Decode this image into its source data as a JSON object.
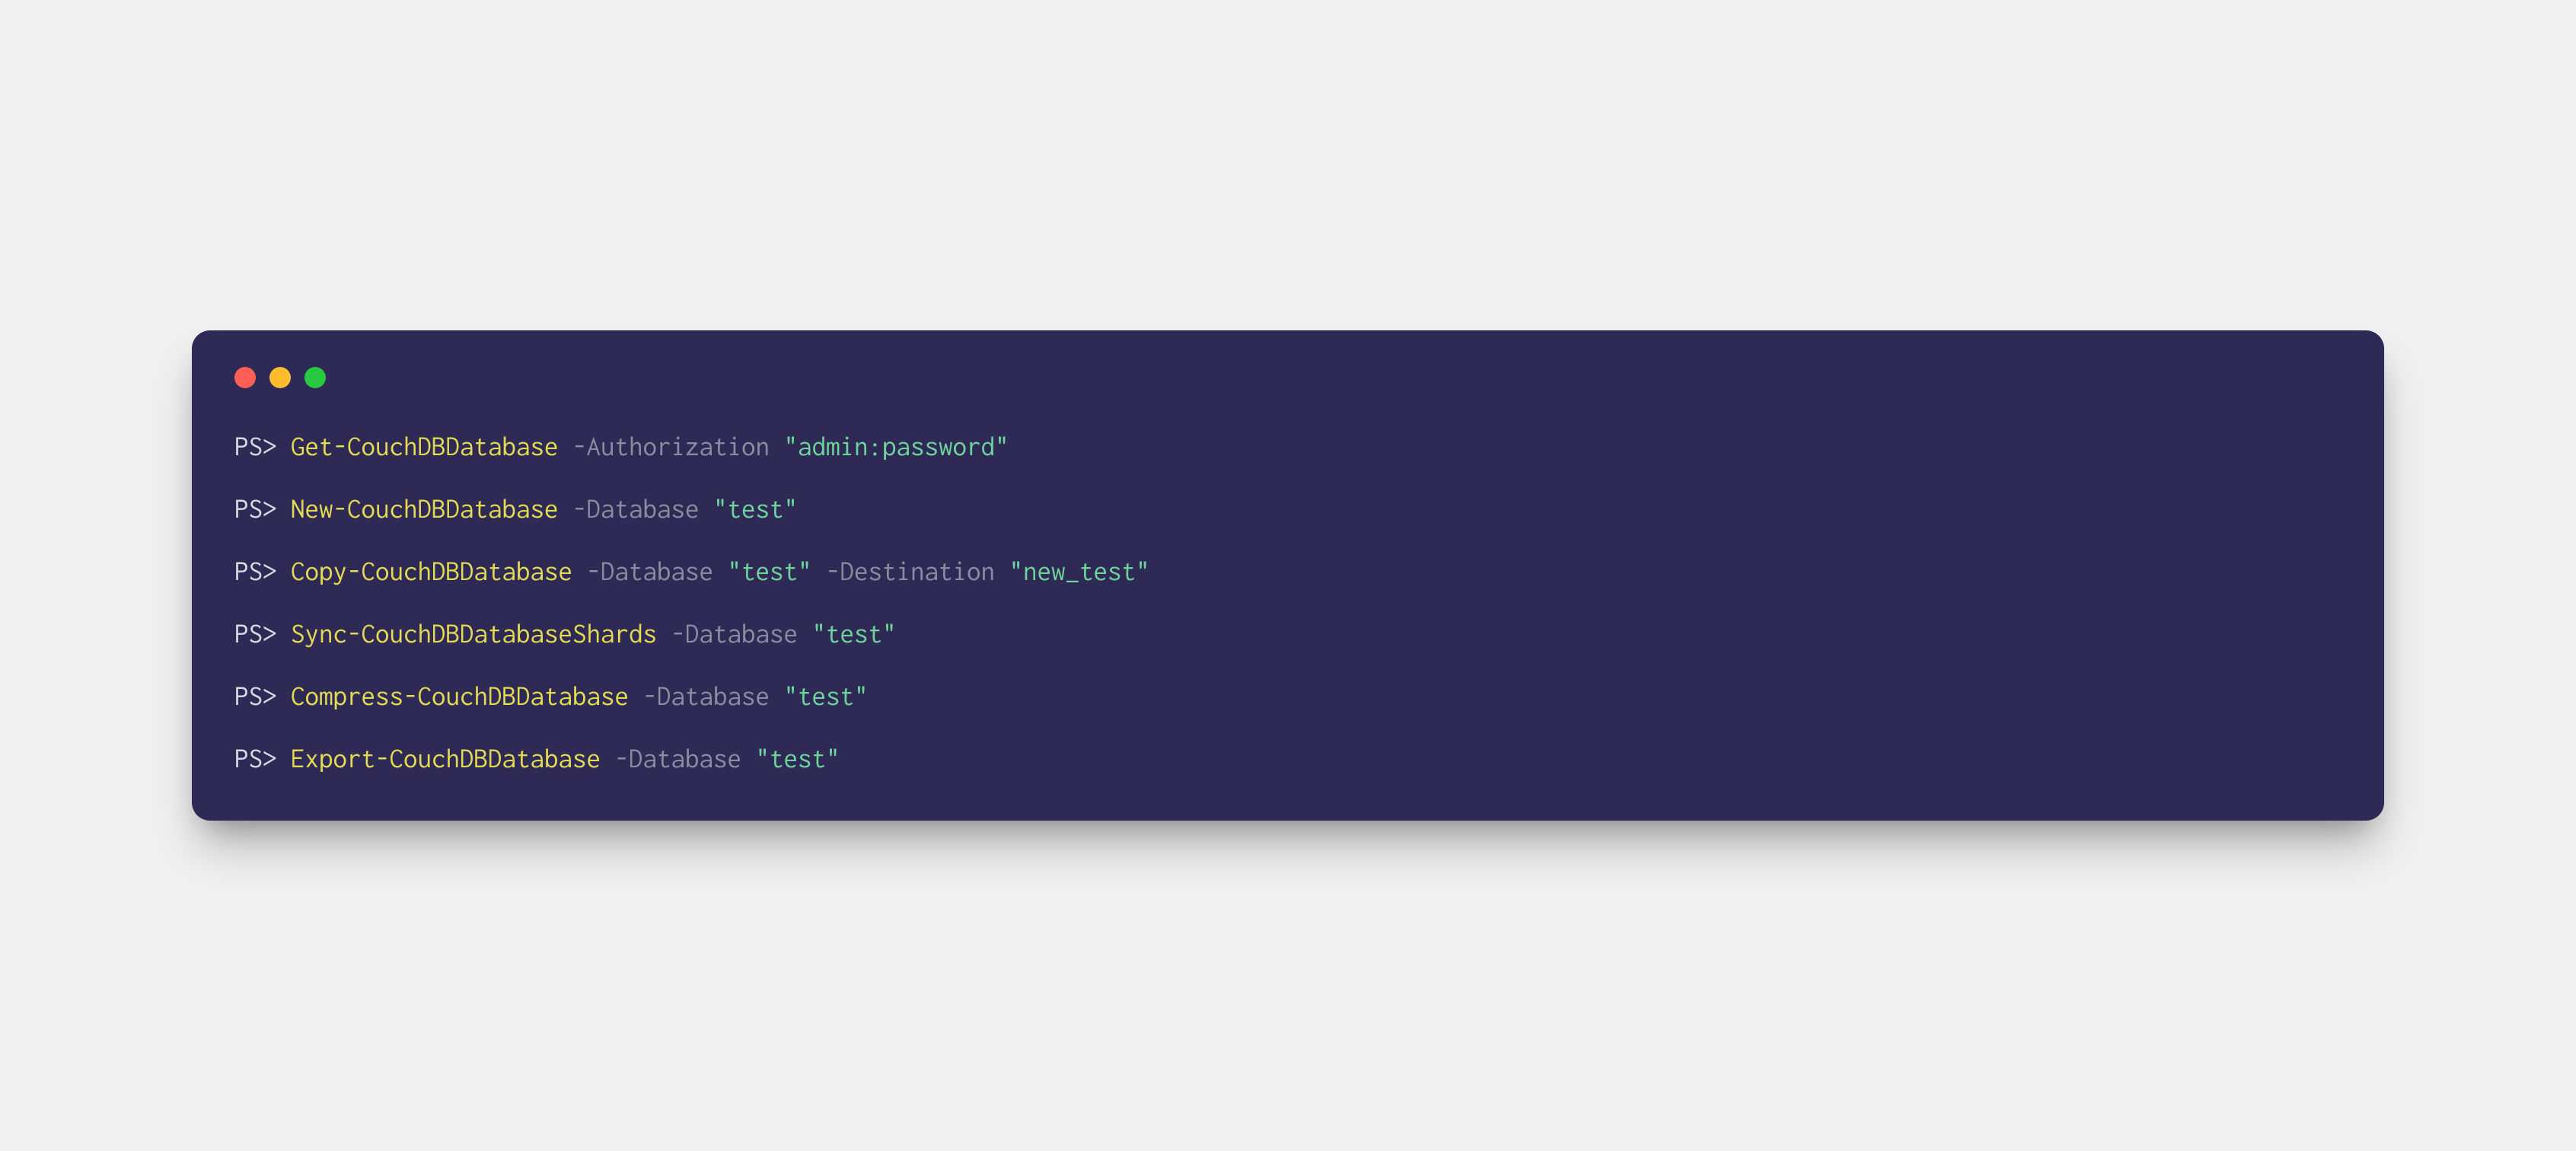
{
  "window": {
    "controls": [
      "close",
      "minimize",
      "maximize"
    ]
  },
  "colors": {
    "background": "#2e2a55",
    "prompt": "#d8dbe4",
    "command": "#e3db54",
    "parameter": "#888da0",
    "string": "#6fd39c"
  },
  "prompt": "PS>",
  "lines": [
    {
      "tokens": [
        {
          "type": "prompt",
          "text": "PS>"
        },
        {
          "type": "plain",
          "text": " "
        },
        {
          "type": "cmd",
          "text": "Get-CouchDBDatabase"
        },
        {
          "type": "plain",
          "text": " "
        },
        {
          "type": "param",
          "text": "-Authorization"
        },
        {
          "type": "plain",
          "text": " "
        },
        {
          "type": "str",
          "text": "\"admin:password\""
        }
      ]
    },
    {
      "tokens": [
        {
          "type": "prompt",
          "text": "PS>"
        },
        {
          "type": "plain",
          "text": " "
        },
        {
          "type": "cmd",
          "text": "New-CouchDBDatabase"
        },
        {
          "type": "plain",
          "text": " "
        },
        {
          "type": "param",
          "text": "-Database"
        },
        {
          "type": "plain",
          "text": " "
        },
        {
          "type": "str",
          "text": "\"test\""
        }
      ]
    },
    {
      "tokens": [
        {
          "type": "prompt",
          "text": "PS>"
        },
        {
          "type": "plain",
          "text": " "
        },
        {
          "type": "cmd",
          "text": "Copy-CouchDBDatabase"
        },
        {
          "type": "plain",
          "text": " "
        },
        {
          "type": "param",
          "text": "-Database"
        },
        {
          "type": "plain",
          "text": " "
        },
        {
          "type": "str",
          "text": "\"test\""
        },
        {
          "type": "plain",
          "text": " "
        },
        {
          "type": "param",
          "text": "-Destination"
        },
        {
          "type": "plain",
          "text": " "
        },
        {
          "type": "str",
          "text": "\"new_test\""
        }
      ]
    },
    {
      "tokens": [
        {
          "type": "prompt",
          "text": "PS>"
        },
        {
          "type": "plain",
          "text": " "
        },
        {
          "type": "cmd",
          "text": "Sync-CouchDBDatabaseShards"
        },
        {
          "type": "plain",
          "text": " "
        },
        {
          "type": "param",
          "text": "-Database"
        },
        {
          "type": "plain",
          "text": " "
        },
        {
          "type": "str",
          "text": "\"test\""
        }
      ]
    },
    {
      "tokens": [
        {
          "type": "prompt",
          "text": "PS>"
        },
        {
          "type": "plain",
          "text": " "
        },
        {
          "type": "cmd",
          "text": "Compress-CouchDBDatabase"
        },
        {
          "type": "plain",
          "text": " "
        },
        {
          "type": "param",
          "text": "-Database"
        },
        {
          "type": "plain",
          "text": " "
        },
        {
          "type": "str",
          "text": "\"test\""
        }
      ]
    },
    {
      "tokens": [
        {
          "type": "prompt",
          "text": "PS>"
        },
        {
          "type": "plain",
          "text": " "
        },
        {
          "type": "cmd",
          "text": "Export-CouchDBDatabase"
        },
        {
          "type": "plain",
          "text": " "
        },
        {
          "type": "param",
          "text": "-Database"
        },
        {
          "type": "plain",
          "text": " "
        },
        {
          "type": "str",
          "text": "\"test\""
        }
      ]
    }
  ]
}
